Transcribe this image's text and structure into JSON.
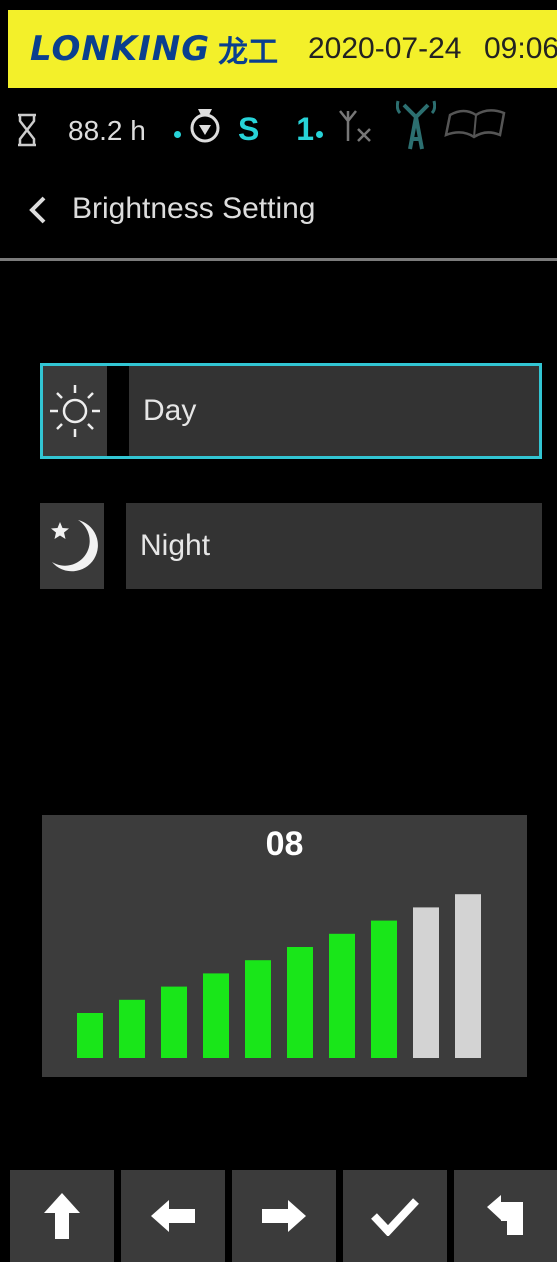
{
  "header": {
    "logo_text": "LONKING",
    "logo_cn": "龙工",
    "date": "2020-07-24",
    "time": "09:06",
    "colors": {
      "bar": "#f3f02a",
      "logo": "#0a3f8f"
    }
  },
  "status_bar": {
    "hours": "88.2 h",
    "gear": "S 1",
    "icons": [
      "hourglass-icon",
      "gear-shift-icon",
      "antenna-off-icon",
      "signal-tower-icon",
      "manual-book-icon"
    ],
    "accent": "#27d3d8"
  },
  "page": {
    "title": "Brightness Setting"
  },
  "options": [
    {
      "label": "Day",
      "icon": "sun-icon",
      "selected": true
    },
    {
      "label": "Night",
      "icon": "moon-icon",
      "selected": false
    }
  ],
  "brightness": {
    "level_text": "08",
    "level": 8,
    "max": 10,
    "active_color": "#19e619",
    "inactive_color": "#d3d3d3"
  },
  "toolbar": {
    "buttons": [
      "up-arrow-icon",
      "left-arrow-icon",
      "right-arrow-icon",
      "confirm-check-icon",
      "return-icon"
    ]
  }
}
